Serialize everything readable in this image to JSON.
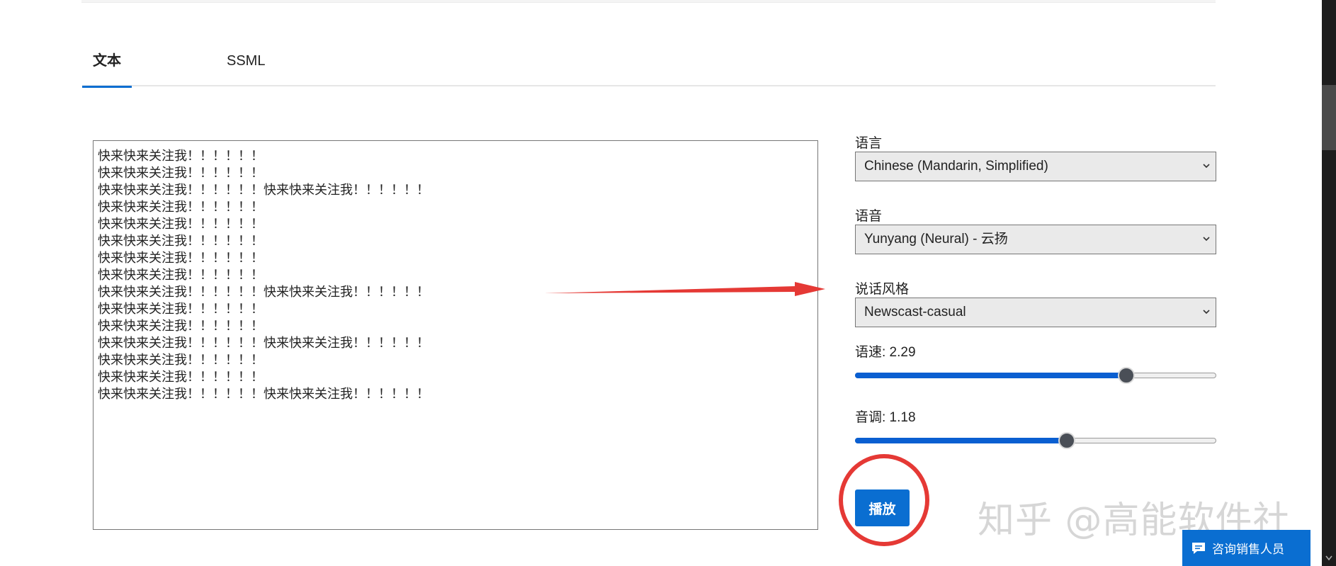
{
  "tabs": {
    "text": "文本",
    "ssml": "SSML"
  },
  "editor": {
    "content": "快来快来关注我！！！！！！\n快来快来关注我！！！！！！\n快来快来关注我！！！！！！快来快来关注我！！！！！！\n快来快来关注我！！！！！！\n快来快来关注我！！！！！！\n快来快来关注我！！！！！！\n快来快来关注我！！！！！！\n快来快来关注我！！！！！！\n快来快来关注我！！！！！！快来快来关注我！！！！！！\n快来快来关注我！！！！！！\n快来快来关注我！！！！！！\n快来快来关注我！！！！！！快来快来关注我！！！！！！\n快来快来关注我！！！！！！\n快来快来关注我！！！！！！\n快来快来关注我！！！！！！快来快来关注我！！！！！！"
  },
  "settings": {
    "language": {
      "label": "语言",
      "value": "Chinese (Mandarin, Simplified)"
    },
    "voice": {
      "label": "语音",
      "value": "Yunyang (Neural) - 云扬"
    },
    "style": {
      "label": "说话风格",
      "value": "Newscast-casual"
    },
    "rate": {
      "label": "语速: 2.29",
      "level": 0.75
    },
    "pitch": {
      "label": "音调: 1.18",
      "level": 0.586
    }
  },
  "actions": {
    "play_label": "播放",
    "contact_label": "咨询销售人员"
  },
  "watermark": "知乎 @高能软件社",
  "colors": {
    "accent": "#0a6ed1",
    "annotation": "#e53935"
  },
  "icons": {
    "chevron": "chevron-down-icon",
    "chat": "chat-icon"
  }
}
